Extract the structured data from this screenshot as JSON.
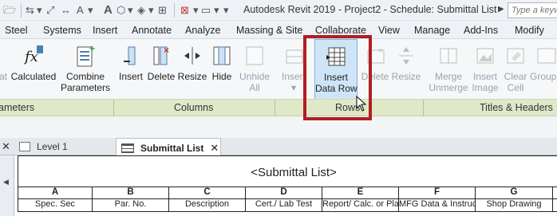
{
  "window": {
    "title": "Autodesk Revit 2019 - Project2 - Schedule: Submittal List",
    "search_placeholder": "Type a keyw"
  },
  "ribbon_tabs": [
    "Steel",
    "Systems",
    "Insert",
    "Annotate",
    "Analyze",
    "Massing & Site",
    "Collaborate",
    "View",
    "Manage",
    "Add-Ins",
    "Modify"
  ],
  "ribbon_buttons": {
    "partial_left": "at",
    "calculated": "Calculated",
    "combine": [
      "Combine",
      "Parameters"
    ],
    "insert_col": "Insert",
    "delete_col": "Delete",
    "resize_col": "Resize",
    "hide_col": "Hide",
    "unhide_col": [
      "Unhide",
      "All"
    ],
    "insert_row": "Insert",
    "insert_data_row": [
      "Insert",
      "Data Row"
    ],
    "delete_row": "Delete",
    "resize_row": "Resize",
    "merge": [
      "Merge",
      "Unmerge"
    ],
    "insert_image": [
      "Insert",
      "Image"
    ],
    "clear_cell": [
      "Clear",
      "Cell"
    ],
    "group_partial": "Group"
  },
  "panels": {
    "parameters": "ameters",
    "columns": "Columns",
    "rows": "Rows",
    "titles_headers": "Titles & Headers"
  },
  "doc_tabs": {
    "level1": "Level 1",
    "submittal": "Submittal List"
  },
  "schedule": {
    "title": "<Submittal List>",
    "columns": [
      "A",
      "B",
      "C",
      "D",
      "E",
      "F",
      "G"
    ],
    "headers": [
      "Spec. Sec",
      "Par. No.",
      "Description",
      "Cert./ Lab Test",
      "Report/ Calc. or Pla",
      "MFG Data & Instruc",
      "Shop Drawing"
    ]
  },
  "colors": {
    "highlight_border": "#b01e23",
    "panel_label_bg": "#dfe9c8",
    "active_button_bg": "#cfe5f7"
  }
}
